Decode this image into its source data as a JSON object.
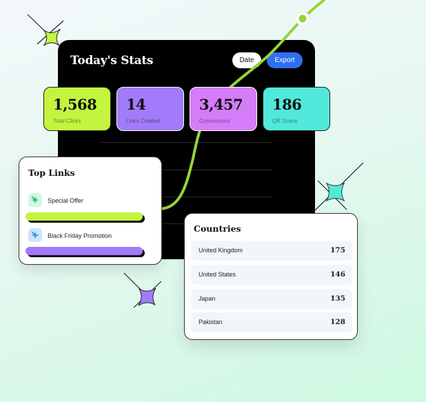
{
  "stats": {
    "title": "Today's Stats",
    "date_label": "Date",
    "export_label": "Export",
    "cards": [
      {
        "value": "1,568",
        "label": "Total Clicks",
        "color": "#c3f53f"
      },
      {
        "value": "14",
        "label": "Links Created",
        "color": "#a27bfb"
      },
      {
        "value": "3,457",
        "label": "Conversions",
        "color": "#d57cf8"
      },
      {
        "value": "186",
        "label": "QR Scans",
        "color": "#52e9dc"
      }
    ]
  },
  "top_links": {
    "title": "Top Links",
    "items": [
      {
        "label": "Special Offer",
        "icon": "sparkle-icon",
        "bar_color": "#c3f53f",
        "icon_bg": "#d3f8e4"
      },
      {
        "label": "Black Friday Promotion",
        "icon": "sparkle-icon",
        "bar_color": "#a27bfb",
        "icon_bg": "#cfe4fb"
      }
    ]
  },
  "countries": {
    "title": "Countries",
    "rows": [
      {
        "name": "United Kingdom",
        "value": "175"
      },
      {
        "name": "United States",
        "value": "146"
      },
      {
        "name": "Japan",
        "value": "135"
      },
      {
        "name": "Pakistan",
        "value": "128"
      }
    ]
  },
  "colors": {
    "accent_line": "#93d53a",
    "export_button": "#2f6ff0",
    "sparkle_green": "#c3f53f",
    "sparkle_teal": "#52e9dc",
    "sparkle_purple": "#a27bfb"
  }
}
